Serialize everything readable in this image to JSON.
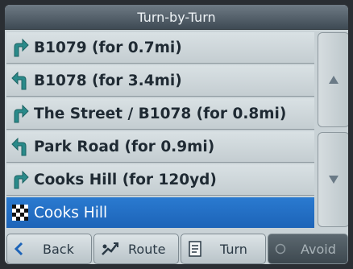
{
  "title": "Turn-by-Turn",
  "colors": {
    "arrow": "#2a8a8a",
    "selected_bg": "#1f6cc2"
  },
  "instructions": [
    {
      "icon": "turn-right-icon",
      "text": "B1079 (for 0.7mi)"
    },
    {
      "icon": "turn-left-icon",
      "text": "B1078 (for 3.4mi)"
    },
    {
      "icon": "turn-right-icon",
      "text": "The Street / B1078 (for 0.8mi)"
    },
    {
      "icon": "turn-left-icon",
      "text": "Park Road (for 0.9mi)"
    },
    {
      "icon": "turn-right-icon",
      "text": "Cooks Hill (for 120yd)"
    },
    {
      "icon": "checkered-flag-icon",
      "text": "Cooks Hill",
      "selected": true
    }
  ],
  "scroll": {
    "up_icon": "triangle-up-icon",
    "down_icon": "triangle-down-icon"
  },
  "toolbar": {
    "back_label": "Back",
    "route_label": "Route",
    "turn_label": "Turn",
    "avoid_label": "Avoid"
  }
}
